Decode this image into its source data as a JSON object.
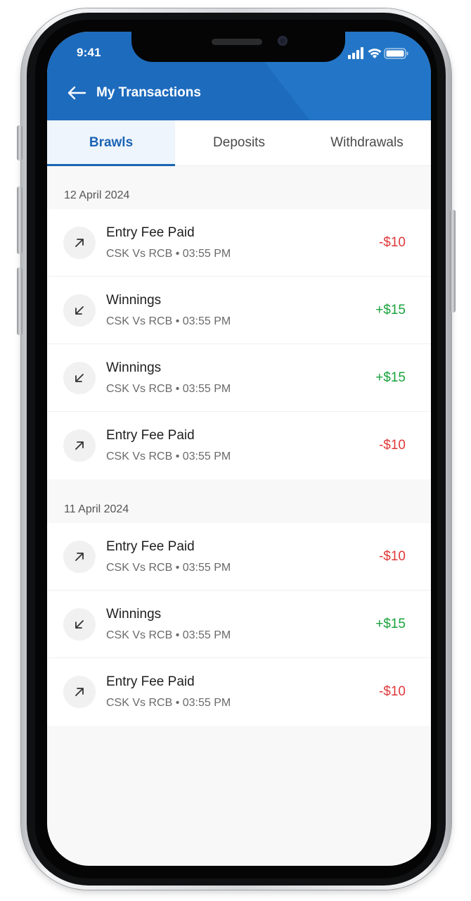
{
  "status_bar": {
    "time": "9:41"
  },
  "header": {
    "title": "My Transactions"
  },
  "tabs": [
    {
      "label": "Brawls",
      "active": true
    },
    {
      "label": "Deposits",
      "active": false
    },
    {
      "label": "Withdrawals",
      "active": false
    }
  ],
  "sections": [
    {
      "date": "12 April 2024",
      "items": [
        {
          "title": "Entry Fee Paid",
          "match": "CSK Vs RCB",
          "time": "03:55 PM",
          "amount": "-$10",
          "direction": "out",
          "icon": "arrow-up-right-icon"
        },
        {
          "title": "Winnings",
          "match": "CSK Vs RCB",
          "time": "03:55 PM",
          "amount": "+$15",
          "direction": "in",
          "icon": "arrow-down-left-icon"
        },
        {
          "title": "Winnings",
          "match": "CSK Vs RCB",
          "time": "03:55 PM",
          "amount": "+$15",
          "direction": "in",
          "icon": "arrow-down-left-icon"
        },
        {
          "title": "Entry Fee Paid",
          "match": "CSK Vs RCB",
          "time": "03:55 PM",
          "amount": "-$10",
          "direction": "out",
          "icon": "arrow-up-right-icon"
        }
      ]
    },
    {
      "date": "11 April 2024",
      "items": [
        {
          "title": "Entry Fee Paid",
          "match": "CSK Vs RCB",
          "time": "03:55 PM",
          "amount": "-$10",
          "direction": "out",
          "icon": "arrow-up-right-icon"
        },
        {
          "title": "Winnings",
          "match": "CSK Vs RCB",
          "time": "03:55 PM",
          "amount": "+$15",
          "direction": "in",
          "icon": "arrow-down-left-icon"
        },
        {
          "title": "Entry Fee Paid",
          "match": "CSK Vs RCB",
          "time": "03:55 PM",
          "amount": "-$10",
          "direction": "out",
          "icon": "arrow-up-right-icon"
        }
      ]
    }
  ],
  "colors": {
    "header_bg": "#1d6bbd",
    "accent": "#1c64b4",
    "negative": "#e0393a",
    "positive": "#1aa33c"
  }
}
